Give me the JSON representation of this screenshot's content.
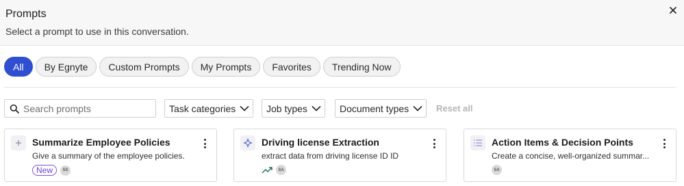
{
  "dialog": {
    "title": "Prompts",
    "subtitle": "Select a prompt to use in this conversation."
  },
  "tabs": [
    {
      "label": "All",
      "active": true
    },
    {
      "label": "By Egnyte",
      "active": false
    },
    {
      "label": "Custom Prompts",
      "active": false
    },
    {
      "label": "My Prompts",
      "active": false
    },
    {
      "label": "Favorites",
      "active": false
    },
    {
      "label": "Trending Now",
      "active": false
    }
  ],
  "filters": {
    "search_placeholder": "Search prompts",
    "task_categories": "Task categories",
    "job_types": "Job types",
    "document_types": "Document types",
    "reset": "Reset all"
  },
  "cards": [
    {
      "icon": "plus-icon",
      "title": "Summarize Employee Policies",
      "description": "Give a summary of the employee policies.",
      "badge": "New",
      "avatar": "SS"
    },
    {
      "icon": "sparkle-icon",
      "title": "Driving license Extraction",
      "description": "extract data from driving license ID ID",
      "trending": true,
      "avatar": "SA"
    },
    {
      "icon": "list-icon",
      "title": "Action Items & Decision Points",
      "description": "Create a concise, well-organized summar...",
      "avatar": "SA"
    }
  ],
  "colors": {
    "accent": "#2f4ed0",
    "new_badge": "#7a52e0"
  }
}
